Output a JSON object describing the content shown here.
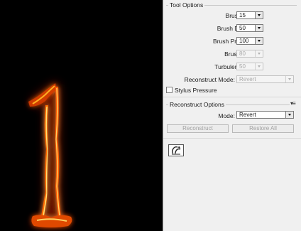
{
  "tool_options": {
    "title": "Tool Options",
    "brush_size": {
      "label": "Brush Size:",
      "value": "15"
    },
    "brush_density": {
      "label": "Brush Density:",
      "value": "50"
    },
    "brush_pressure": {
      "label": "Brush Pressure:",
      "value": "100"
    },
    "brush_rate": {
      "label": "Brush Rate:",
      "value": "80"
    },
    "turbulent_jitter": {
      "label": "Turbulent Jitter:",
      "value": "50"
    },
    "reconstruct_mode": {
      "label": "Reconstruct Mode:",
      "value": "Revert"
    },
    "stylus_pressure": {
      "label": "Stylus Pressure",
      "checked": false
    }
  },
  "reconstruct_options": {
    "title": "Reconstruct Options",
    "mode": {
      "label": "Mode:",
      "value": "Revert"
    },
    "reconstruct_button": "Reconstruct",
    "restore_all_button": "Restore All"
  },
  "icons": {
    "panel_menu": "panel-menu-icon",
    "tool_preset": "tool-preset-icon"
  },
  "colors": {
    "preview_background": "#000000",
    "panel_background": "#f0f0f0",
    "flame_core": "#ffd060",
    "flame_edge": "#e03000"
  }
}
